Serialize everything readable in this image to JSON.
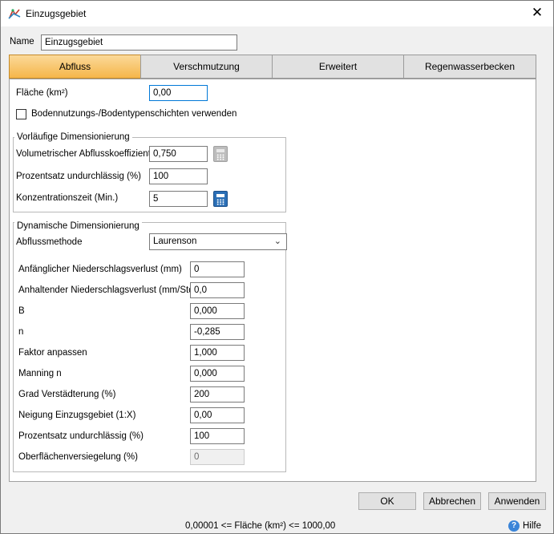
{
  "window": {
    "title": "Einzugsgebiet",
    "close_symbol": "✕"
  },
  "name_field": {
    "label": "Name",
    "value": "Einzugsgebiet"
  },
  "tabs": [
    {
      "label": "Abfluss",
      "active": true
    },
    {
      "label": "Verschmutzung",
      "active": false
    },
    {
      "label": "Erweitert",
      "active": false
    },
    {
      "label": "Regenwasserbecken",
      "active": false
    }
  ],
  "area": {
    "label": "Fläche (km²)",
    "value": "0,00"
  },
  "soil_layers": {
    "label": "Bodennutzungs-/Bodentypenschichten verwenden",
    "checked": false
  },
  "preliminary": {
    "title": "Vorläufige Dimensionierung",
    "runoff_coeff": {
      "label": "Volumetrischer Abflusskoeffizient",
      "value": "0,750"
    },
    "impervious": {
      "label": "Prozentsatz undurchlässig (%)",
      "value": "100"
    },
    "concentration": {
      "label": "Konzentrationszeit (Min.)",
      "value": "5"
    }
  },
  "dynamic": {
    "title": "Dynamische Dimensionierung",
    "method": {
      "label": "Abflussmethode",
      "value": "Laurenson"
    },
    "fields": [
      {
        "label": "Anfänglicher Niederschlagsverlust (mm)",
        "value": "0"
      },
      {
        "label": "Anhaltender Niederschlagsverlust (mm/Std.)",
        "value": "0,0"
      },
      {
        "label": "B",
        "value": "0,000"
      },
      {
        "label": "n",
        "value": "-0,285"
      },
      {
        "label": "Faktor anpassen",
        "value": "1,000"
      },
      {
        "label": "Manning n",
        "value": "0,000"
      },
      {
        "label": "Grad Verstädterung (%)",
        "value": "200"
      },
      {
        "label": "Neigung Einzugsgebiet (1:X)",
        "value": "0,00"
      },
      {
        "label": "Prozentsatz undurchlässig (%)",
        "value": "100"
      },
      {
        "label": "Oberflächenversiegelung (%)",
        "value": "0"
      }
    ]
  },
  "buttons": {
    "ok": "OK",
    "cancel": "Abbrechen",
    "apply": "Anwenden"
  },
  "status": {
    "hint": "0,00001 <= Fläche (km²) <= 1000,00",
    "help": "Hilfe",
    "help_glyph": "?"
  },
  "colors": {
    "active_tab": "#f5b64a",
    "focus_border": "#0078d7",
    "calc_blue": "#2b6fb6"
  }
}
